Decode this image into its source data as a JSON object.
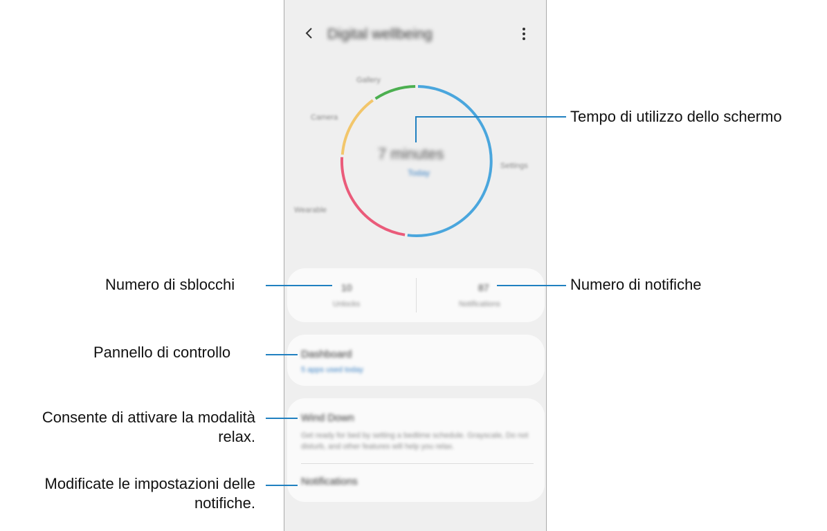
{
  "phone": {
    "header": {
      "title": "Digital wellbeing",
      "back_icon": "chevron-left-icon",
      "more_icon": "more-vertical-icon"
    },
    "usage": {
      "total_time": "7 minutes",
      "today_link": "Today",
      "app_labels": [
        "Gallery",
        "Camera",
        "Settings",
        "Wearable"
      ],
      "ring_colors": [
        "#4caf50",
        "#f2c66b",
        "#ea5b7a",
        "#4aa6dd"
      ]
    },
    "stats": {
      "unlocks_value": "10",
      "unlocks_label": "Unlocks",
      "notifications_value": "87",
      "notifications_label": "Notifications"
    },
    "dashboard": {
      "title": "Dashboard",
      "subtitle": "5 apps used today"
    },
    "settings": {
      "wind_down_title": "Wind Down",
      "wind_down_desc": "Get ready for bed by setting a bedtime schedule. Grayscale, Do not disturb, and other features will help you relax.",
      "notifications_title": "Notifications"
    }
  },
  "callouts": {
    "screen_time": "Tempo di utilizzo dello schermo",
    "unlocks": "Numero di sblocchi",
    "notifications": "Numero di notifiche",
    "dashboard": "Pannello di controllo",
    "relax_line1": "Consente di attivare la modalità",
    "relax_line2": "relax.",
    "notif_settings_line1": "Modificate le impostazioni delle",
    "notif_settings_line2": "notifiche."
  }
}
